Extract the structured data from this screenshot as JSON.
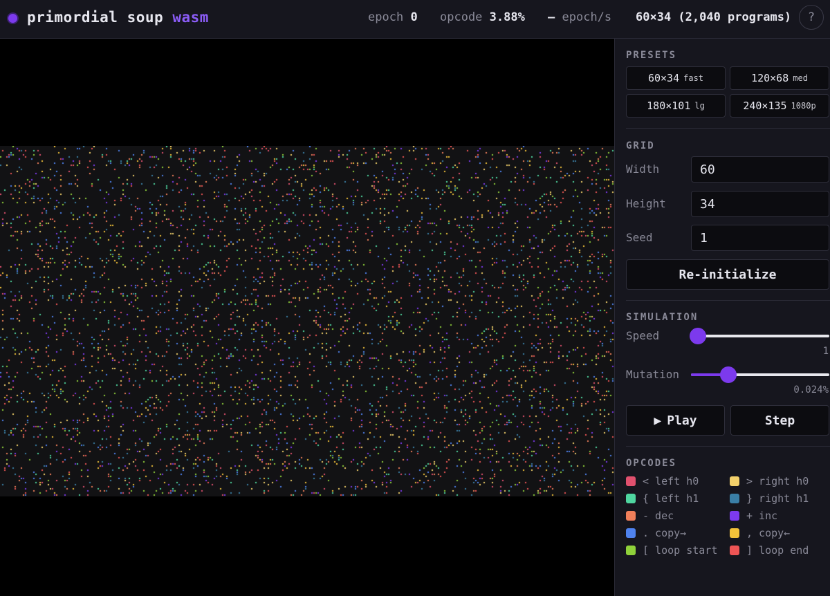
{
  "header": {
    "brand_main": "primordial soup",
    "brand_accent": "wasm",
    "epoch_label": "epoch",
    "epoch_value": "0",
    "opcode_label": "opcode",
    "opcode_value": "3.88%",
    "rate_value": "—",
    "rate_label": "epoch/s",
    "grid_info": "60×34 (2,040 programs)",
    "help_label": "?"
  },
  "presets": {
    "title": "PRESETS",
    "items": [
      {
        "label": "60×34",
        "tag": "fast"
      },
      {
        "label": "120×68",
        "tag": "med"
      },
      {
        "label": "180×101",
        "tag": "lg"
      },
      {
        "label": "240×135",
        "tag": "1080p"
      }
    ]
  },
  "grid": {
    "title": "GRID",
    "width_label": "Width",
    "width_value": "60",
    "height_label": "Height",
    "height_value": "34",
    "seed_label": "Seed",
    "seed_value": "1",
    "reinit_label": "Re-initialize"
  },
  "simulation": {
    "title": "SIMULATION",
    "speed_label": "Speed",
    "speed_value": "1",
    "speed_fraction": 0.05,
    "mutation_label": "Mutation",
    "mutation_value": "0.024%",
    "mutation_fraction": 0.27,
    "play_label": "Play",
    "step_label": "Step"
  },
  "opcodes": {
    "title": "OPCODES",
    "items": [
      {
        "label": "< left h0",
        "color": "#e0506e"
      },
      {
        "label": "> right h0",
        "color": "#f2d06b"
      },
      {
        "label": "{ left h1",
        "color": "#4fd6a0"
      },
      {
        "label": "} right h1",
        "color": "#3a7fa6"
      },
      {
        "label": "- dec",
        "color": "#f07f5a"
      },
      {
        "label": "+ inc",
        "color": "#7c3aed"
      },
      {
        "label": ". copy→",
        "color": "#4f82ee"
      },
      {
        "label": ", copy←",
        "color": "#f2c23a"
      },
      {
        "label": "[ loop start",
        "color": "#8fd13a"
      },
      {
        "label": "] loop end",
        "color": "#ee5555"
      }
    ]
  }
}
